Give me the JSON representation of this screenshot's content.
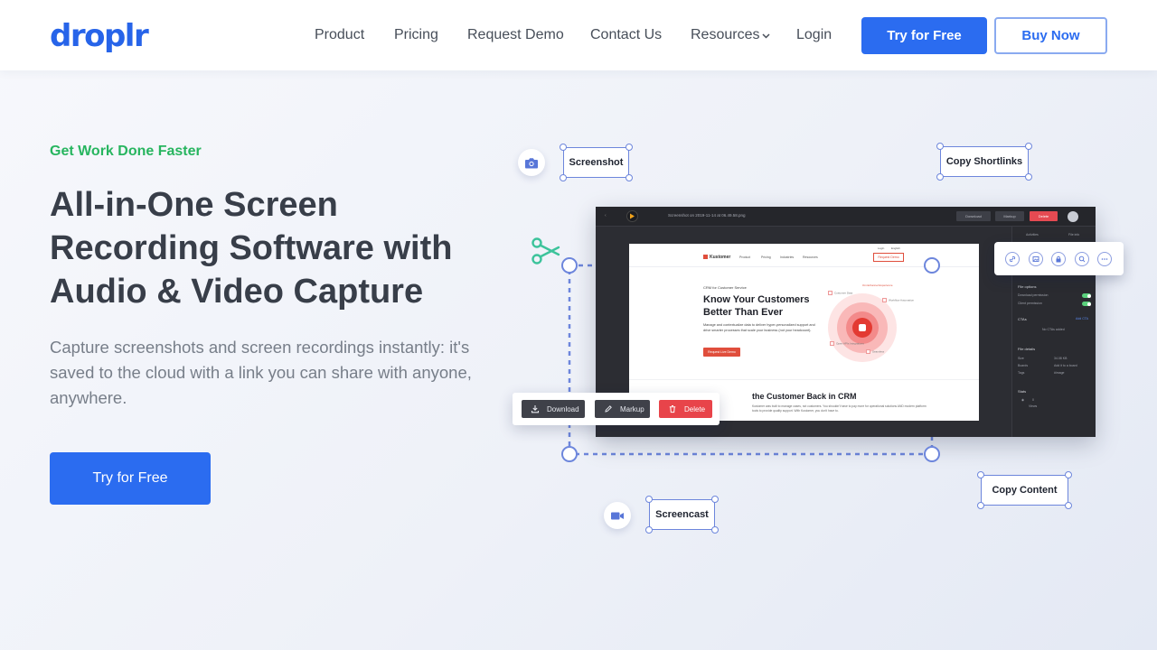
{
  "nav": {
    "logo": "droplr",
    "links": [
      "Product",
      "Pricing",
      "Request Demo",
      "Contact Us",
      "Resources",
      "Login"
    ],
    "try_label": "Try for Free",
    "buy_label": "Buy Now"
  },
  "hero": {
    "eyebrow": "Get Work Done Faster",
    "headline": "All-in-One Screen Recording Software with Audio & Video Capture",
    "subtext": "Capture screenshots and screen recordings instantly: it's saved to the cloud with a link you can share with anyone, anywhere.",
    "cta_label": "Try for Free"
  },
  "illustration": {
    "labels": {
      "screenshot": "Screenshot",
      "copy_shortlinks": "Copy Shortlinks",
      "screencast": "Screencast",
      "copy_content": "Copy Content"
    },
    "app": {
      "filename": "Screenshot on 2019-11-14 at 06.49.58.png",
      "top_buttons": [
        "Download",
        "Markup",
        "Delete"
      ],
      "inner": {
        "brand": "Kustomer",
        "nav": [
          "Product",
          "Pricing",
          "Industries",
          "Resources"
        ],
        "login": [
          "Login",
          "English"
        ],
        "demo": "Request Demo",
        "eyebrow": "CRM for Customer Service",
        "title": "Know Your Customers Better Than Ever",
        "body": "Manage and contextualize data to deliver hyper-personalized support and drive smarter processes that scale your business (not your headcount).",
        "cta": "Request Live Demo",
        "tags": [
          "Omnichannel Experience",
          "Workflow Automation",
          "Open APIs Integrations",
          "Customer Data",
          "Seamless"
        ],
        "subtitle": "the Customer Back in CRM",
        "sub_body": "Kustomer was built to manage cases, not customers. You shouldn't have to pay more for operational solutions AND modern platform tools to provide quality support. With Kustomer, you don't have to."
      },
      "side_panel": {
        "tabs": [
          "Activities",
          "File info"
        ],
        "file_options": "File options",
        "download_permission": "Download permission",
        "client_permission": "Client permission",
        "ctas": "CTAs",
        "add_cta": "Add CTA",
        "no_ctas": "No CTAs added",
        "file_details": "File details",
        "size_label": "Size",
        "size_value": "34.08 KB",
        "boards_label": "Boards",
        "boards_value": "Add it to a board",
        "tags_label": "Tags",
        "tags_value": "#image",
        "stats": "Stats",
        "views_value": "0",
        "views_label": "Views"
      }
    },
    "actions": [
      "Download",
      "Markup",
      "Delete"
    ],
    "colors": {
      "brand_blue": "#2b6cf0",
      "eyebrow_green": "#27b55f",
      "selection_blue": "#6d86dc",
      "delete_red": "#e8444a"
    },
    "icons": [
      "camera-icon",
      "scissors-icon",
      "video-camera-icon",
      "link-icon",
      "image-icon",
      "lock-icon",
      "search-icon",
      "more-icon"
    ]
  }
}
